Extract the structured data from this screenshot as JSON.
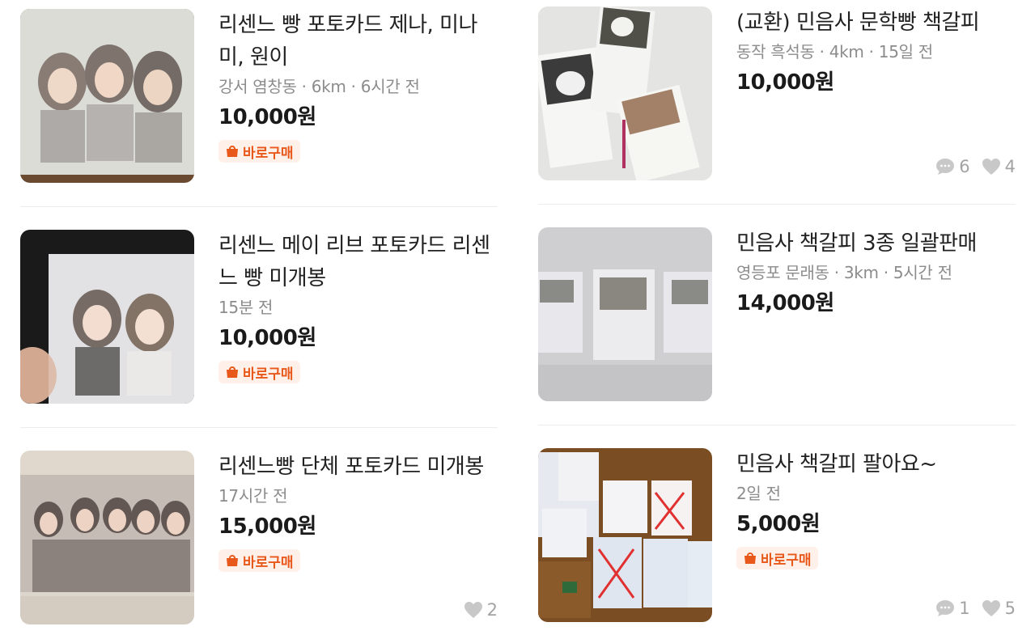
{
  "left": [
    {
      "title": "리센느 빵 포토카드 제나, 미나미, 원이",
      "meta": "강서 염창동 · 6km · 6시간 전",
      "price": "10,000원",
      "badge": "바로구매",
      "image": "photocard-three-girls"
    },
    {
      "title": "리센느 메이 리브 포토카드 리센느 빵 미개봉",
      "meta": "15분 전",
      "price": "10,000원",
      "badge": "바로구매",
      "image": "photocard-two-girls"
    },
    {
      "title": "리센느빵 단체 포토카드 미개봉",
      "meta": "17시간 전",
      "price": "15,000원",
      "badge": "바로구매",
      "likes": "2",
      "image": "photocard-group"
    }
  ],
  "right": [
    {
      "title": "(교환) 민음사 문학빵 책갈피",
      "meta": "동작 흑석동 · 4km · 15일 전",
      "price": "10,000원",
      "comments": "6",
      "likes": "4",
      "image": "bookmarks-three"
    },
    {
      "title": "민음사 책갈피 3종 일괄판매",
      "meta": "영등포 문래동 · 3km · 5시간 전",
      "price": "14,000원",
      "image": "bookmarks-wrapped"
    },
    {
      "title": "민음사 책갈피 팔아요~",
      "meta": "2일 전",
      "price": "5,000원",
      "badge": "바로구매",
      "comments": "1",
      "likes": "5",
      "image": "bookmarks-on-table"
    }
  ],
  "colors": {
    "accent": "#e8581a",
    "badge_bg": "#fff1e9",
    "muted": "#8c8c8c"
  }
}
